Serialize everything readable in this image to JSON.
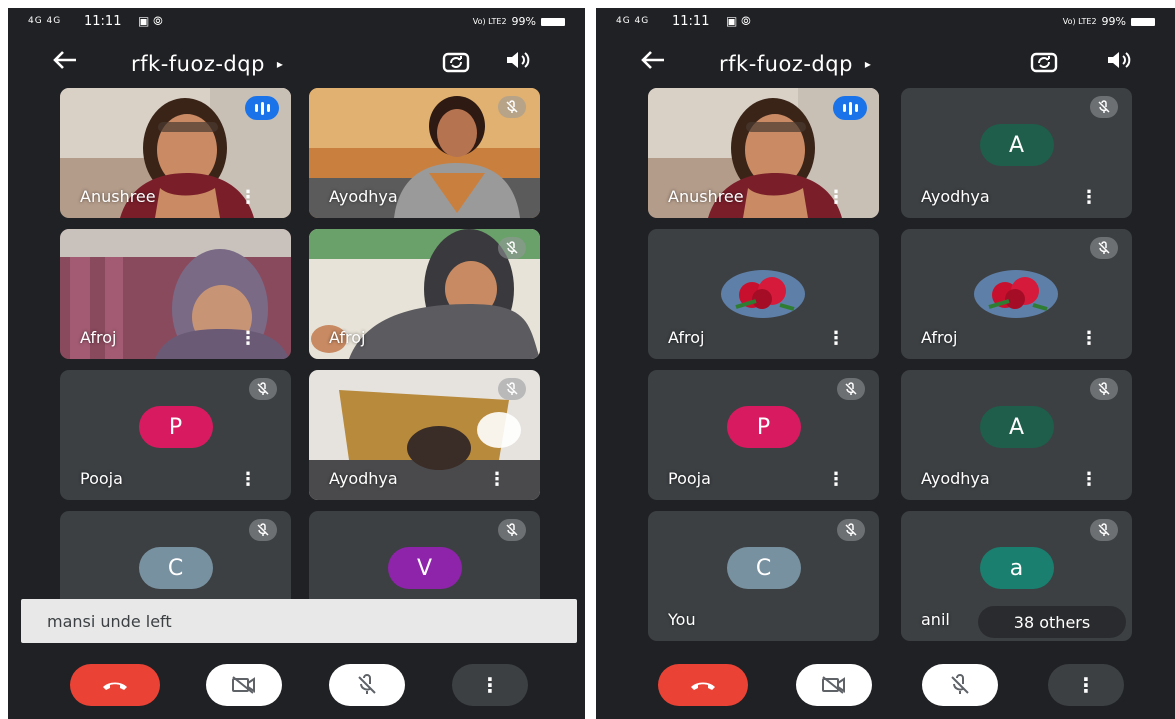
{
  "status": {
    "time": "11:11",
    "network": "4G 4G",
    "apps": "▣ ⦾",
    "battery": "99%",
    "volte": "Vo) LTE2"
  },
  "header": {
    "room": "rfk-fuoz-dqp",
    "caret": "▸"
  },
  "left": {
    "tiles": [
      {
        "name": "Anushree",
        "more": "⋮"
      },
      {
        "name": "Ayodhya",
        "more": ""
      },
      {
        "name": "Afroj",
        "more": "⋮"
      },
      {
        "name": "Afroj",
        "more": ""
      },
      {
        "name": "Pooja",
        "more": "⋮",
        "initial": "P"
      },
      {
        "name": "Ayodhya",
        "more": "⋮"
      },
      {
        "name": "",
        "more": "",
        "initial": "C"
      },
      {
        "name": "",
        "more": "",
        "initial": "V"
      }
    ],
    "toast": "mansi unde left"
  },
  "right": {
    "tiles": [
      {
        "name": "Anushree",
        "more": "⋮"
      },
      {
        "name": "Ayodhya",
        "more": "⋮",
        "initial": "A"
      },
      {
        "name": "Afroj",
        "more": "⋮"
      },
      {
        "name": "Afroj",
        "more": "⋮"
      },
      {
        "name": "Pooja",
        "more": "⋮",
        "initial": "P"
      },
      {
        "name": "Ayodhya",
        "more": "⋮",
        "initial": "A"
      },
      {
        "name": "You",
        "more": "",
        "initial": "C"
      },
      {
        "name": "anil",
        "more": "",
        "initial": "a"
      }
    ],
    "others": "38 others"
  },
  "controls": {
    "more_label": "⋮"
  },
  "colors": {
    "background": "#202124",
    "tile": "#3c4043",
    "end_call": "#ea4335",
    "avatar_p": "#d81b60",
    "avatar_a": "#1e5e4a",
    "avatar_c": "#7891a0",
    "avatar_v": "#8e24aa",
    "avatar_a_small": "#1a7f6f",
    "speaking": "#1a73e8"
  },
  "icons": {
    "back": "arrow-left-icon",
    "switch_camera": "switch-camera-icon",
    "speaker": "speaker-icon",
    "muted": "mic-off-icon",
    "speaking": "audio-level-icon",
    "end_call": "phone-hangup-icon",
    "camera_off": "camera-off-icon",
    "mic_off": "mic-off-icon",
    "more": "more-vert-icon"
  }
}
